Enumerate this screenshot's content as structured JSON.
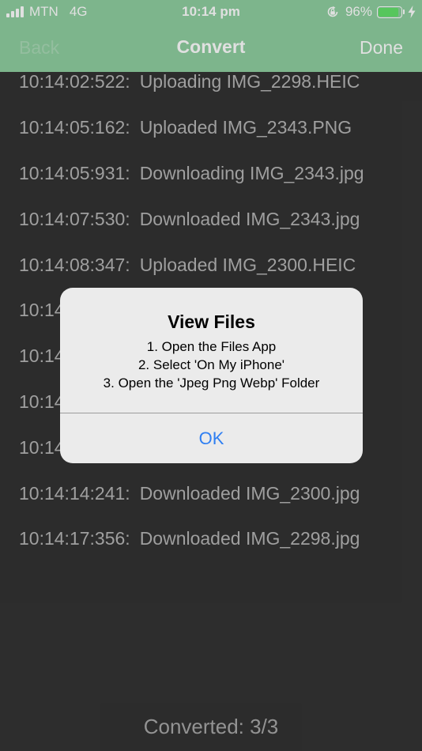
{
  "status_bar": {
    "carrier": "MTN",
    "network": "4G",
    "time": "10:14 pm",
    "battery_percent": "96%",
    "battery_level": 0.96,
    "icons": [
      "signal-bars-icon",
      "orientation-lock-icon",
      "battery-icon",
      "charging-bolt-icon"
    ]
  },
  "nav": {
    "back_label": "Back",
    "title": "Convert",
    "done_label": "Done"
  },
  "log": [
    {
      "time": "10:14:02:522:",
      "message": "Uploading IMG_2298.HEIC"
    },
    {
      "time": "10:14:05:162:",
      "message": "Uploaded IMG_2343.PNG"
    },
    {
      "time": "10:14:05:931:",
      "message": "Downloading IMG_2343.jpg"
    },
    {
      "time": "10:14:07:530:",
      "message": "Downloaded IMG_2343.jpg"
    },
    {
      "time": "10:14:08:347:",
      "message": "Uploaded IMG_2300.HEIC"
    },
    {
      "time": "10:14",
      "message": ""
    },
    {
      "time": "10:14",
      "message": ""
    },
    {
      "time": "10:14",
      "message": ""
    },
    {
      "time": "10:14",
      "message": ""
    },
    {
      "time": "10:14:14:241:",
      "message": "Downloaded IMG_2300.jpg"
    },
    {
      "time": "10:14:17:356:",
      "message": "Downloaded IMG_2298.jpg"
    }
  ],
  "footer": {
    "converted": "Converted: 3/3"
  },
  "alert": {
    "title": "View Files",
    "lines": [
      "1. Open the Files App",
      "2. Select 'On My iPhone'",
      "3. Open the 'Jpeg Png Webp' Folder"
    ],
    "ok_label": "OK"
  },
  "colors": {
    "nav_background": "#8fcfa0",
    "page_background": "#333333",
    "log_text": "#b5b5b5",
    "alert_background": "#ebebeb",
    "alert_button": "#2f7ff2",
    "battery_fill": "#64e26a"
  }
}
